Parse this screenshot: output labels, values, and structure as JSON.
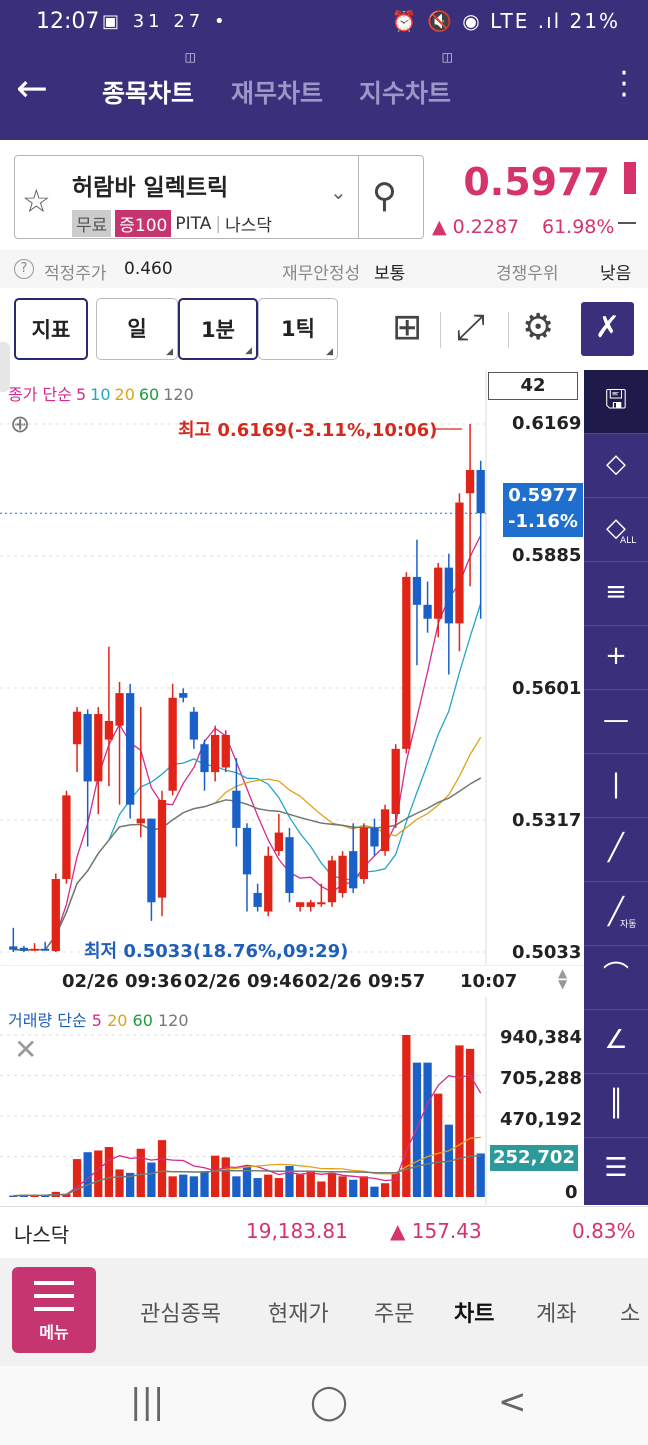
{
  "status_bar": {
    "time": "12:07",
    "left_icons": "▣ 31 27 •",
    "right_icons": "⏰ 🔇 ◉ LTE .ıl",
    "battery": "21%"
  },
  "header": {
    "back_glyph": "←",
    "tabs": [
      {
        "label": "종목차트",
        "active": true
      },
      {
        "label": "재무차트",
        "active": false
      },
      {
        "label": "지수차트",
        "active": false
      }
    ],
    "more_glyph": "⋮"
  },
  "stock": {
    "name": "허람바 일렉트릭",
    "tags": [
      "무료",
      "증100"
    ],
    "ticker": "PITA",
    "exchange": "나스닥",
    "price": "0.5977",
    "change": "▲ 0.2287",
    "change_pct": "61.98%"
  },
  "info_bar": {
    "help": "?",
    "fair_label": "적정주가",
    "fair_value": "0.460",
    "stability_label": "재무안정성",
    "stability_value": "보통",
    "rank_label": "경쟁우위",
    "rank_value": "낮음"
  },
  "toolbar": {
    "indicator": "지표",
    "day": "일",
    "min1": "1분",
    "tick1": "1틱"
  },
  "price_chart": {
    "legend_prefix": "종가 단순",
    "legend_periods": [
      "5",
      "10",
      "20",
      "60",
      "120"
    ],
    "legend_colors": [
      "#d52b8c",
      "#23a5c9",
      "#e0a21c",
      "#1f9b3a",
      "#777777"
    ],
    "box_value": "42",
    "axis_labels": [
      "0.6169",
      "0.5885",
      "0.5601",
      "0.5317",
      "0.5033"
    ],
    "current_price": "0.5977",
    "current_pct": "-1.16%",
    "high_label": "최고 0.6169(-3.11%,10:06)",
    "low_label": "최저 0.5033(18.76%,09:29)",
    "x_labels": [
      "02/26 09:36",
      "02/26 09:46",
      "02/26 09:57",
      "10:07"
    ]
  },
  "volume_chart": {
    "legend_prefix": "거래량 단순",
    "legend_periods": [
      "5",
      "20",
      "60",
      "120"
    ],
    "legend_colors": [
      "#d52b8c",
      "#e0a21c",
      "#1f9b3a",
      "#777777"
    ],
    "axis_labels": [
      "940,384",
      "705,288",
      "470,192",
      "0"
    ],
    "current_volume": "252,702"
  },
  "chart_data": {
    "type": "candlestick",
    "ylim": [
      0.5033,
      0.6169
    ],
    "candles": [
      {
        "o": 0.5045,
        "h": 0.5085,
        "l": 0.5033,
        "c": 0.5038
      },
      {
        "o": 0.5042,
        "h": 0.5046,
        "l": 0.5033,
        "c": 0.5036
      },
      {
        "o": 0.5038,
        "h": 0.5052,
        "l": 0.5035,
        "c": 0.504
      },
      {
        "o": 0.504,
        "h": 0.5055,
        "l": 0.5036,
        "c": 0.5038
      },
      {
        "o": 0.5035,
        "h": 0.5202,
        "l": 0.5033,
        "c": 0.519
      },
      {
        "o": 0.519,
        "h": 0.538,
        "l": 0.518,
        "c": 0.537
      },
      {
        "o": 0.548,
        "h": 0.556,
        "l": 0.542,
        "c": 0.555
      },
      {
        "o": 0.5545,
        "h": 0.5555,
        "l": 0.526,
        "c": 0.54
      },
      {
        "o": 0.54,
        "h": 0.556,
        "l": 0.533,
        "c": 0.5545
      },
      {
        "o": 0.549,
        "h": 0.569,
        "l": 0.539,
        "c": 0.553
      },
      {
        "o": 0.552,
        "h": 0.5614,
        "l": 0.535,
        "c": 0.559
      },
      {
        "o": 0.559,
        "h": 0.561,
        "l": 0.532,
        "c": 0.535
      },
      {
        "o": 0.531,
        "h": 0.556,
        "l": 0.528,
        "c": 0.532
      },
      {
        "o": 0.532,
        "h": 0.532,
        "l": 0.51,
        "c": 0.514
      },
      {
        "o": 0.515,
        "h": 0.538,
        "l": 0.511,
        "c": 0.536
      },
      {
        "o": 0.538,
        "h": 0.561,
        "l": 0.537,
        "c": 0.558
      },
      {
        "o": 0.559,
        "h": 0.56,
        "l": 0.557,
        "c": 0.558
      },
      {
        "o": 0.555,
        "h": 0.556,
        "l": 0.547,
        "c": 0.549
      },
      {
        "o": 0.548,
        "h": 0.549,
        "l": 0.538,
        "c": 0.542
      },
      {
        "o": 0.542,
        "h": 0.552,
        "l": 0.54,
        "c": 0.55
      },
      {
        "o": 0.543,
        "h": 0.551,
        "l": 0.542,
        "c": 0.55
      },
      {
        "o": 0.538,
        "h": 0.545,
        "l": 0.526,
        "c": 0.53
      },
      {
        "o": 0.53,
        "h": 0.531,
        "l": 0.512,
        "c": 0.52
      },
      {
        "o": 0.516,
        "h": 0.518,
        "l": 0.512,
        "c": 0.513
      },
      {
        "o": 0.512,
        "h": 0.526,
        "l": 0.511,
        "c": 0.524
      },
      {
        "o": 0.525,
        "h": 0.533,
        "l": 0.524,
        "c": 0.529
      },
      {
        "o": 0.528,
        "h": 0.53,
        "l": 0.514,
        "c": 0.516
      },
      {
        "o": 0.513,
        "h": 0.514,
        "l": 0.512,
        "c": 0.514
      },
      {
        "o": 0.513,
        "h": 0.5145,
        "l": 0.512,
        "c": 0.514
      },
      {
        "o": 0.514,
        "h": 0.518,
        "l": 0.513,
        "c": 0.514
      },
      {
        "o": 0.514,
        "h": 0.524,
        "l": 0.513,
        "c": 0.523
      },
      {
        "o": 0.516,
        "h": 0.525,
        "l": 0.515,
        "c": 0.524
      },
      {
        "o": 0.525,
        "h": 0.531,
        "l": 0.516,
        "c": 0.517
      },
      {
        "o": 0.519,
        "h": 0.531,
        "l": 0.518,
        "c": 0.53
      },
      {
        "o": 0.53,
        "h": 0.532,
        "l": 0.524,
        "c": 0.526
      },
      {
        "o": 0.525,
        "h": 0.535,
        "l": 0.524,
        "c": 0.534
      },
      {
        "o": 0.533,
        "h": 0.548,
        "l": 0.53,
        "c": 0.547
      },
      {
        "o": 0.547,
        "h": 0.585,
        "l": 0.546,
        "c": 0.584
      },
      {
        "o": 0.584,
        "h": 0.592,
        "l": 0.565,
        "c": 0.578
      },
      {
        "o": 0.578,
        "h": 0.583,
        "l": 0.572,
        "c": 0.575
      },
      {
        "o": 0.575,
        "h": 0.587,
        "l": 0.571,
        "c": 0.586
      },
      {
        "o": 0.586,
        "h": 0.589,
        "l": 0.563,
        "c": 0.574
      },
      {
        "o": 0.574,
        "h": 0.602,
        "l": 0.568,
        "c": 0.6
      },
      {
        "o": 0.602,
        "h": 0.6169,
        "l": 0.582,
        "c": 0.607
      },
      {
        "o": 0.607,
        "h": 0.609,
        "l": 0.575,
        "c": 0.5977
      }
    ],
    "volume": [
      8000,
      10000,
      9000,
      12000,
      30000,
      18000,
      220000,
      260000,
      270000,
      290000,
      160000,
      140000,
      280000,
      200000,
      330000,
      120000,
      130000,
      120000,
      150000,
      240000,
      230000,
      120000,
      180000,
      110000,
      130000,
      110000,
      180000,
      130000,
      150000,
      90000,
      140000,
      120000,
      100000,
      120000,
      60000,
      80000,
      140000,
      940384,
      780000,
      780000,
      600000,
      420000,
      880000,
      860000,
      252702
    ],
    "volume_ylim": [
      0,
      940384
    ]
  },
  "index_bar": {
    "name": "나스닥",
    "value": "19,183.81",
    "change": "▲ 157.43",
    "pct": "0.83%"
  },
  "bottom_nav": {
    "menu_label": "메뉴",
    "items": [
      "관심종목",
      "현재가",
      "주문",
      "차트",
      "계좌",
      "소"
    ],
    "active": "차트"
  },
  "system_nav": {
    "recent": "|||",
    "home": "◯",
    "back": "<"
  }
}
